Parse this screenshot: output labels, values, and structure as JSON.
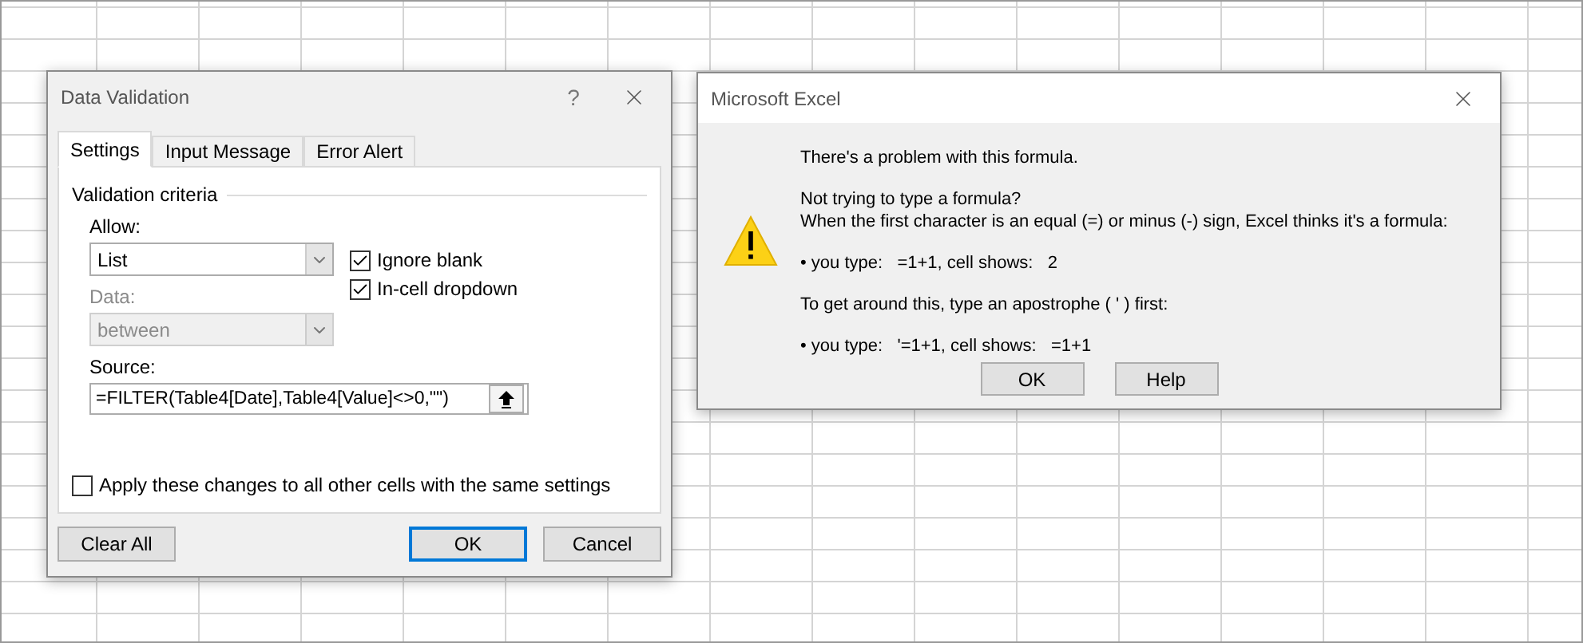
{
  "validation_dialog": {
    "title": "Data Validation",
    "help": "?",
    "tabs": [
      {
        "label": "Settings",
        "selected": true
      },
      {
        "label": "Input Message",
        "selected": false
      },
      {
        "label": "Error Alert",
        "selected": false
      }
    ],
    "group_label": "Validation criteria",
    "combos": [
      {
        "label": "Allow:",
        "value": "List",
        "disabled": false
      },
      {
        "label": "Data:",
        "value": "between",
        "disabled": true
      }
    ],
    "options": [
      {
        "label": "Ignore blank",
        "checked": true
      },
      {
        "label": "In-cell dropdown",
        "checked": true
      }
    ],
    "source": {
      "label": "Source:",
      "value": "=FILTER(Table4[Date],Table4[Value]<>0,\"\")"
    },
    "apply_all": {
      "label": "Apply these changes to all other cells with the same settings",
      "checked": false
    },
    "buttons": [
      {
        "label": "Clear All",
        "default": false
      },
      {
        "label": "OK",
        "default": true
      },
      {
        "label": "Cancel",
        "default": false
      }
    ]
  },
  "alert_dialog": {
    "title": "Microsoft Excel",
    "paragraphs": [
      [
        "There's a problem with this formula."
      ],
      [
        "Not trying to type a formula?",
        "When the first character is an equal (=) or minus (-) sign, Excel thinks it's a formula:"
      ],
      [
        "• you type:   =1+1, cell shows:   2"
      ],
      [
        "To get around this, type an apostrophe ( ' ) first:"
      ],
      [
        "• you type:   '=1+1, cell shows:   =1+1"
      ]
    ],
    "buttons": [
      {
        "label": "OK"
      },
      {
        "label": "Help"
      }
    ]
  }
}
